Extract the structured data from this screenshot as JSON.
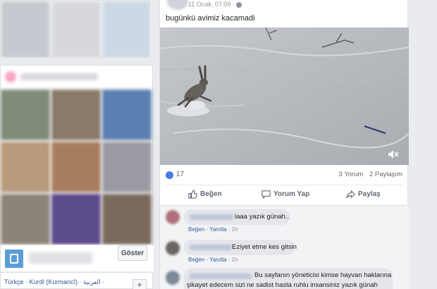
{
  "left_sidebar": {
    "show_button": "Göster",
    "languages": "Türkçe · Kurdî (Kurmancî) · العربية ·",
    "add_label": "+"
  },
  "post": {
    "timestamp": "11 Ocak, 07:09 ·",
    "caption": "bugünkü avimiz kacamadi",
    "likes": "17",
    "comments_count": "3 Yorum",
    "shares_count": "2 Paylaşım",
    "actions": {
      "like": "Beğen",
      "comment": "Yorum Yap",
      "share": "Paylaş"
    }
  },
  "comments": [
    {
      "text": "laaa yazık günah..",
      "like": "Beğen",
      "reply": "Yanıtla",
      "time": "1h"
    },
    {
      "text": "Eziyet etme kes gitsin",
      "like": "Beğen",
      "reply": "Yanıtla",
      "time": "1h"
    },
    {
      "text_line1": "Bu sayfanın yöneticisi kimse hayvan haklarına",
      "text_line2": "şikayet edecem sizi ne sadist hasta ruhlu insansiniz yazık günah"
    }
  ],
  "colors": {
    "link": "#365899",
    "like_blue": "#4a79e5",
    "bg": "#e9ebee"
  }
}
